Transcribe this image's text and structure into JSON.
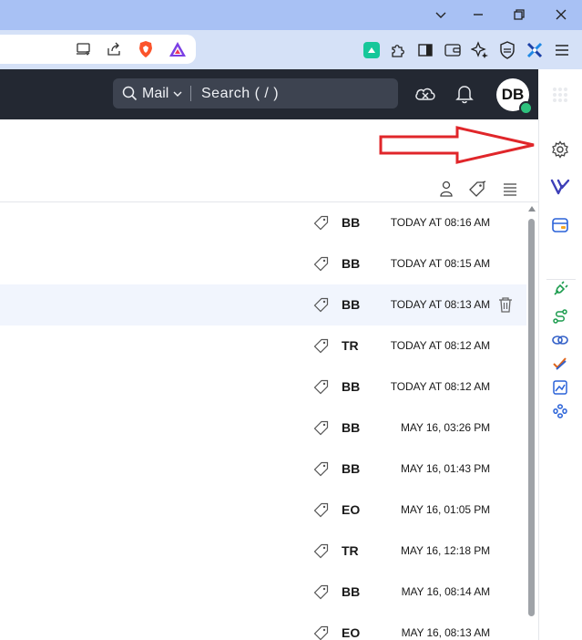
{
  "browser": {
    "window_controls": [
      "chevron-down-icon",
      "minimize-icon",
      "restore-icon",
      "close-icon"
    ],
    "toolbar_icons": [
      "cast-icon",
      "share-icon",
      "brave-shields-icon",
      "brave-rewards-icon",
      "extension-app-icon",
      "extensions-puzzle-icon",
      "sidebar-toggle-icon",
      "wallet-icon",
      "leo-ai-icon",
      "vpn-icon",
      "extension-x-icon",
      "menu-icon"
    ]
  },
  "mail_header": {
    "search_scope": "Mail",
    "search_placeholder": "Search ( / )",
    "avatar_initials": "DB",
    "presence_color": "#2ec27e"
  },
  "annotation": {
    "arrow_color": "#e0262a"
  },
  "sidebar": {
    "icons": [
      "settings-gear-icon",
      "vivaldi-icon",
      "wallet-card-icon",
      "plug-icon",
      "route-icon",
      "link-icon",
      "pencil-check-icon",
      "image-chart-icon",
      "grid-puzzle-icon"
    ]
  },
  "list_toolbar": {
    "icons": [
      "contact-person-icon",
      "tag-icon",
      "list-menu-icon"
    ]
  },
  "messages": [
    {
      "sender": "BB",
      "date": "TODAY AT 08:16 AM"
    },
    {
      "sender": "BB",
      "date": "TODAY AT 08:15 AM"
    },
    {
      "sender": "BB",
      "date": "TODAY AT 08:13 AM",
      "highlighted": true
    },
    {
      "sender": "TR",
      "date": "TODAY AT 08:12 AM"
    },
    {
      "sender": "BB",
      "date": "TODAY AT 08:12 AM"
    },
    {
      "sender": "BB",
      "date": "MAY 16, 03:26 PM"
    },
    {
      "sender": "BB",
      "date": "MAY 16, 01:43 PM"
    },
    {
      "sender": "EO",
      "date": "MAY 16, 01:05 PM"
    },
    {
      "sender": "TR",
      "date": "MAY 16, 12:18 PM"
    },
    {
      "sender": "BB",
      "date": "MAY 16, 08:14 AM"
    },
    {
      "sender": "EO",
      "date": "MAY 16, 08:13 AM"
    }
  ]
}
